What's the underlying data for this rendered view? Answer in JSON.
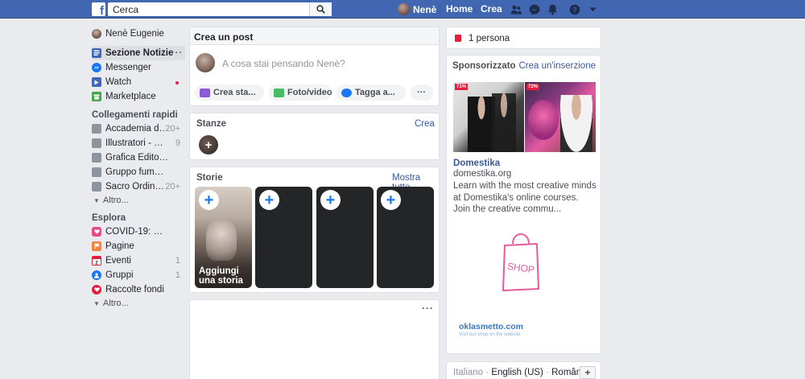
{
  "topbar": {
    "logo": "f",
    "search_placeholder": "Cerca",
    "user_name": "Nenè",
    "home": "Home",
    "create": "Crea"
  },
  "sidebar": {
    "profile_name": "Nenè Eugenie",
    "news_feed": "Sezione Notizie",
    "news_feed_more": "···",
    "messenger": "Messenger",
    "watch": "Watch",
    "marketplace": "Marketplace",
    "shortcuts_title": "Collegamenti rapidi",
    "shortcuts": [
      {
        "label": "Accademia di ...",
        "count": "20+"
      },
      {
        "label": "Illustratori - S.I...",
        "count": "9"
      },
      {
        "label": "Grafica Editori...",
        "count": ""
      },
      {
        "label": "Gruppo fumett...",
        "count": ""
      },
      {
        "label": "Sacro Ordine ...",
        "count": "20+"
      }
    ],
    "shortcuts_more": "Altro...",
    "explore_title": "Esplora",
    "explore": [
      {
        "label": "COVID-19: Ce...",
        "count": ""
      },
      {
        "label": "Pagine",
        "count": ""
      },
      {
        "label": "Eventi",
        "count": "1"
      },
      {
        "label": "Gruppi",
        "count": "1"
      },
      {
        "label": "Raccolte fondi",
        "count": ""
      }
    ],
    "explore_more": "Altro..."
  },
  "composer": {
    "title": "Crea un post",
    "placeholder": "A cosa stai pensando Nenè?",
    "buttons": [
      "Crea sta...",
      "Foto/video",
      "Tagga a...",
      "···"
    ]
  },
  "rooms": {
    "title": "Stanze",
    "create": "Crea",
    "plus": "+"
  },
  "stories": {
    "title": "Storie",
    "show_all": "Mostra tutte",
    "add_story": "Aggiungi una storia",
    "plus": "+"
  },
  "feed": {
    "more": "···"
  },
  "right": {
    "birthday": "1 persona",
    "sponsored_title": "Sponsorizzato",
    "create_ad": "Crea un'inserzione",
    "ad": {
      "tag1": "71%",
      "tag2": "72%",
      "title": "Domestika",
      "domain": "domestika.org",
      "text": "Learn with the most creative minds at Domestika's online courses. Join the creative commu...",
      "shop_word": "SHOP",
      "brand": "oklasmetto.com",
      "brand_sub": "Visit our shop on the website"
    },
    "languages": [
      "Italiano",
      "English (US)",
      "Română"
    ],
    "lang_sep": " · ",
    "lang_plus": "+"
  }
}
